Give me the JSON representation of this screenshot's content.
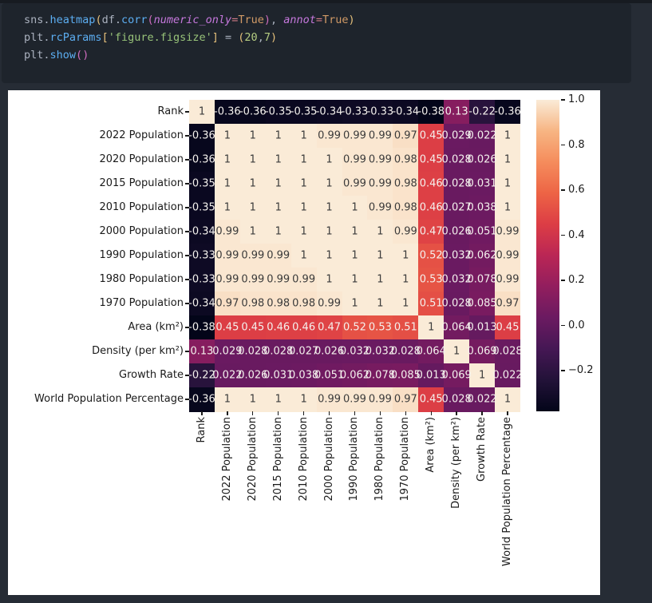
{
  "code": {
    "lines": [
      [
        {
          "t": "sns",
          "c": "fg"
        },
        {
          "t": ".",
          "c": "fg"
        },
        {
          "t": "heatmap",
          "c": "fn"
        },
        {
          "t": "(",
          "c": "b1"
        },
        {
          "t": "df",
          "c": "fg"
        },
        {
          "t": ".",
          "c": "fg"
        },
        {
          "t": "corr",
          "c": "fn"
        },
        {
          "t": "(",
          "c": "b2"
        },
        {
          "t": "numeric_only",
          "c": "param"
        },
        {
          "t": "=",
          "c": "op"
        },
        {
          "t": "True",
          "c": "const"
        },
        {
          "t": ")",
          "c": "b2"
        },
        {
          "t": ", ",
          "c": "fg"
        },
        {
          "t": "annot",
          "c": "param"
        },
        {
          "t": "=",
          "c": "op"
        },
        {
          "t": "True",
          "c": "const"
        },
        {
          "t": ")",
          "c": "b1"
        }
      ],
      [
        {
          "t": "plt",
          "c": "fg"
        },
        {
          "t": ".",
          "c": "fg"
        },
        {
          "t": "rcParams",
          "c": "fn"
        },
        {
          "t": "[",
          "c": "b1"
        },
        {
          "t": "'figure.figsize'",
          "c": "str"
        },
        {
          "t": "]",
          "c": "b1"
        },
        {
          "t": " = ",
          "c": "fg"
        },
        {
          "t": "(",
          "c": "b1"
        },
        {
          "t": "20",
          "c": "num"
        },
        {
          "t": ",",
          "c": "fg"
        },
        {
          "t": "7",
          "c": "num"
        },
        {
          "t": ")",
          "c": "b1"
        }
      ],
      [
        {
          "t": "plt",
          "c": "fg"
        },
        {
          "t": ".",
          "c": "fg"
        },
        {
          "t": "show",
          "c": "fn"
        },
        {
          "t": "(",
          "c": "b2"
        },
        {
          "t": ")",
          "c": "b2"
        }
      ]
    ]
  },
  "chart_data": {
    "type": "heatmap",
    "title": "",
    "colormap": "rocket",
    "vmin": -0.38,
    "vmax": 1.0,
    "labels": [
      "Rank",
      "2022 Population",
      "2020 Population",
      "2015 Population",
      "2010 Population",
      "2000 Population",
      "1990 Population",
      "1980 Population",
      "1970 Population",
      "Area (km²)",
      "Density (per km²)",
      "Growth Rate",
      "World Population Percentage"
    ],
    "matrix": [
      [
        "1",
        "-0.36",
        "-0.36",
        "-0.35",
        "-0.35",
        "-0.34",
        "-0.33",
        "-0.33",
        "-0.34",
        "-0.38",
        "0.13",
        "-0.22",
        "-0.36"
      ],
      [
        "-0.36",
        "1",
        "1",
        "1",
        "1",
        "0.99",
        "0.99",
        "0.99",
        "0.97",
        "0.45",
        "0.029",
        "0.022",
        "1"
      ],
      [
        "-0.36",
        "1",
        "1",
        "1",
        "1",
        "1",
        "0.99",
        "0.99",
        "0.98",
        "0.45",
        "0.028",
        "0.026",
        "1"
      ],
      [
        "-0.35",
        "1",
        "1",
        "1",
        "1",
        "1",
        "0.99",
        "0.99",
        "0.98",
        "0.46",
        "0.028",
        "0.031",
        "1"
      ],
      [
        "-0.35",
        "1",
        "1",
        "1",
        "1",
        "1",
        "1",
        "0.99",
        "0.98",
        "0.46",
        "0.027",
        "0.038",
        "1"
      ],
      [
        "-0.34",
        "0.99",
        "1",
        "1",
        "1",
        "1",
        "1",
        "1",
        "0.99",
        "0.47",
        "0.026",
        "0.051",
        "0.99"
      ],
      [
        "-0.33",
        "0.99",
        "0.99",
        "0.99",
        "1",
        "1",
        "1",
        "1",
        "1",
        "0.52",
        "0.032",
        "0.062",
        "0.99"
      ],
      [
        "-0.33",
        "0.99",
        "0.99",
        "0.99",
        "0.99",
        "1",
        "1",
        "1",
        "1",
        "0.53",
        "0.032",
        "0.078",
        "0.99"
      ],
      [
        "-0.34",
        "0.97",
        "0.98",
        "0.98",
        "0.98",
        "0.99",
        "1",
        "1",
        "1",
        "0.51",
        "0.028",
        "0.085",
        "0.97"
      ],
      [
        "-0.38",
        "0.45",
        "0.45",
        "0.46",
        "0.46",
        "0.47",
        "0.52",
        "0.53",
        "0.51",
        "1",
        "0.064",
        "0.013",
        "0.45"
      ],
      [
        "0.13",
        "0.029",
        "0.028",
        "0.028",
        "0.027",
        "0.026",
        "0.032",
        "0.032",
        "0.028",
        "0.064",
        "1",
        "0.069",
        "0.028"
      ],
      [
        "-0.22",
        "0.022",
        "0.026",
        "0.031",
        "0.038",
        "0.051",
        "0.062",
        "0.078",
        "0.085",
        "0.013",
        "0.069",
        "1",
        "0.022"
      ],
      [
        "-0.36",
        "1",
        "1",
        "1",
        "1",
        "0.99",
        "0.99",
        "0.99",
        "0.97",
        "0.45",
        "0.028",
        "0.022",
        "1"
      ]
    ],
    "colorbar_ticks": [
      "1.0",
      "0.8",
      "0.6",
      "0.4",
      "0.2",
      "0.0",
      "−0.2"
    ],
    "colorbar_tick_values": [
      1.0,
      0.8,
      0.6,
      0.4,
      0.2,
      0.0,
      -0.2
    ]
  },
  "colors": {
    "page_bg": "#262c35",
    "code_panel_bg": "#1e242c",
    "figure_bg": "#ffffff",
    "annot_light": "#f4f1ed",
    "annot_dark": "#3b3b3b"
  }
}
